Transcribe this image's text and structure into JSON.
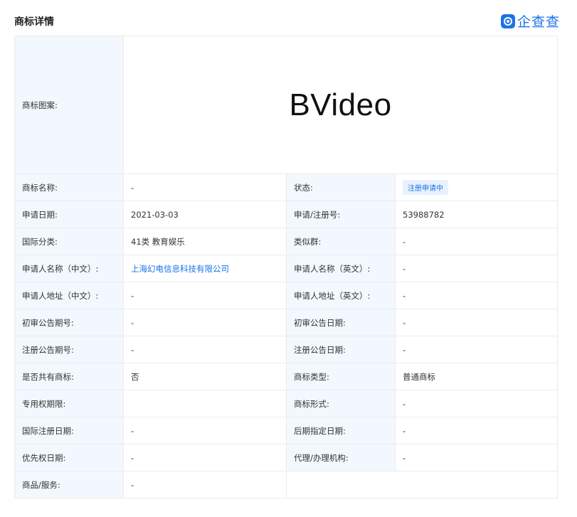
{
  "header": {
    "title": "商标详情",
    "brand": "企查查",
    "brand_color": "#1a73e8"
  },
  "logo": {
    "label": "商标图案:",
    "text": "BVideo"
  },
  "rows": [
    {
      "l1": "商标名称:",
      "v1": "-",
      "l2": "状态:",
      "v2": "注册申请中"
    },
    {
      "l1": "申请日期:",
      "v1": "2021-03-03",
      "l2": "申请/注册号:",
      "v2": "53988782"
    },
    {
      "l1": "国际分类:",
      "v1": "41类 教育娱乐",
      "l2": "类似群:",
      "v2": "-"
    },
    {
      "l1": "申请人名称（中文）:",
      "v1": "上海幻电信息科技有限公司",
      "l2": "申请人名称（英文）:",
      "v2": "-"
    },
    {
      "l1": "申请人地址（中文）:",
      "v1": "-",
      "l2": "申请人地址（英文）:",
      "v2": "-"
    },
    {
      "l1": "初审公告期号:",
      "v1": "-",
      "l2": "初审公告日期:",
      "v2": "-"
    },
    {
      "l1": "注册公告期号:",
      "v1": "-",
      "l2": "注册公告日期:",
      "v2": "-"
    },
    {
      "l1": "是否共有商标:",
      "v1": "否",
      "l2": "商标类型:",
      "v2": "普通商标"
    },
    {
      "l1": "专用权期限:",
      "v1": "",
      "l2": "商标形式:",
      "v2": "-"
    },
    {
      "l1": "国际注册日期:",
      "v1": "-",
      "l2": "后期指定日期:",
      "v2": "-"
    },
    {
      "l1": "优先权日期:",
      "v1": "-",
      "l2": "代理/办理机构:",
      "v2": "-"
    }
  ],
  "goods": {
    "label": "商品/服务:",
    "value": "-"
  }
}
